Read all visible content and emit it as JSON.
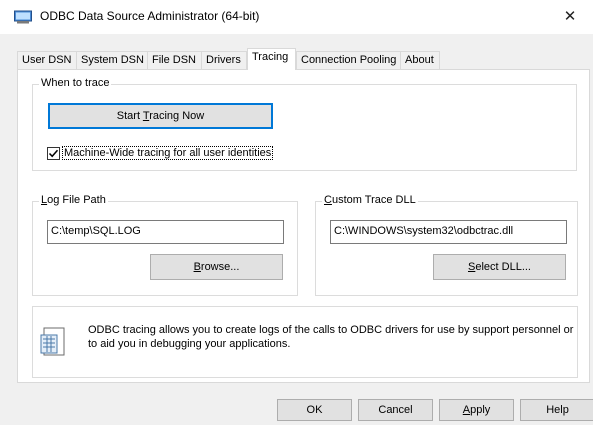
{
  "window": {
    "title": "ODBC Data Source Administrator (64-bit)",
    "close_glyph": "✕"
  },
  "tabs": [
    {
      "label": "User DSN"
    },
    {
      "label": "System DSN"
    },
    {
      "label": "File DSN"
    },
    {
      "label": "Drivers"
    },
    {
      "label": "Tracing",
      "active": true
    },
    {
      "label": "Connection Pooling"
    },
    {
      "label": "About"
    }
  ],
  "when_to_trace": {
    "title": "When to trace",
    "start_button": {
      "pre": "Start ",
      "u": "T",
      "post": "racing Now"
    },
    "machine_wide": {
      "label": "Machine-Wide tracing for all user identities",
      "checked": true
    }
  },
  "log_file": {
    "title": {
      "u": "L",
      "post": "og File Path"
    },
    "path": "C:\\temp\\SQL.LOG",
    "browse_button": {
      "u": "B",
      "post": "rowse..."
    }
  },
  "trace_dll": {
    "title": {
      "u": "C",
      "post": "ustom Trace DLL"
    },
    "path": "C:\\WINDOWS\\system32\\odbctrac.dll",
    "select_button": {
      "u": "S",
      "post": "elect DLL..."
    }
  },
  "info": {
    "icon": "database-info-icon",
    "text": "ODBC tracing allows you to create logs of the calls to ODBC drivers for use by support personnel or to aid you in debugging your applications."
  },
  "footer": {
    "ok": "OK",
    "cancel": "Cancel",
    "apply": {
      "u": "A",
      "post": "pply"
    },
    "help": "Help"
  }
}
